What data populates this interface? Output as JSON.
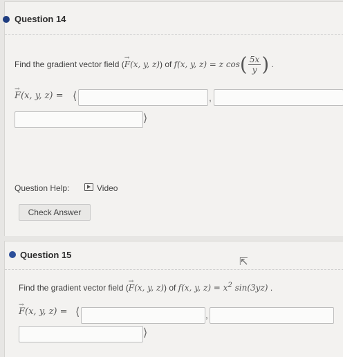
{
  "q14": {
    "title": "Question 14",
    "prompt": "Find the gradient vector field (",
    "vecF": "F",
    "args": "(x, y, z)",
    "of": ") of ",
    "f": "f(x, y, z) = z cos",
    "num": "5x",
    "den": "y",
    "period": ".",
    "lhs_args": "(x, y, z) =",
    "langle": "⟨",
    "rangle": "⟩",
    "comma1": ",",
    "comma2": ",",
    "help_label": "Question Help:",
    "video_label": "Video",
    "check_label": "Check Answer"
  },
  "q15": {
    "title": "Question 15",
    "prompt": "Find the gradient vector field (",
    "vecF": "F",
    "args": "(x, y, z)",
    "of": ") of ",
    "f": "f(x, y, z) = x",
    "exp": "2",
    "rest": " sin(3yz)",
    "period": ".",
    "lhs_args": "(x, y, z) =",
    "langle": "⟨",
    "rangle": "⟩",
    "comma1": ",",
    "comma2": ","
  },
  "colors": {
    "dot14": "#1f3d80",
    "dot15": "#2c4f9a"
  },
  "icons": {
    "video": "video-play-icon",
    "cursor": "mouse-pointer-icon"
  }
}
